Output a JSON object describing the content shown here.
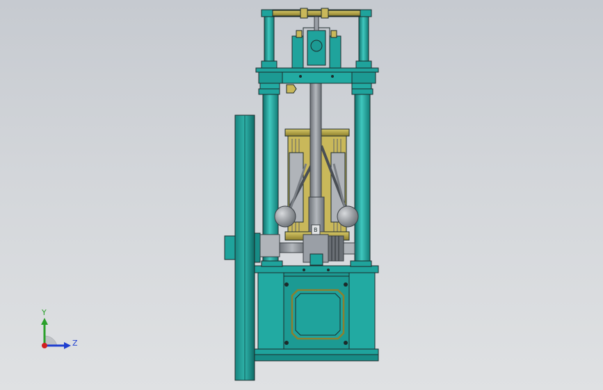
{
  "viewport": {
    "background_top": "#c6cad0",
    "background_bottom": "#dfe1e3"
  },
  "model": {
    "part_colors": {
      "teal": "#1fa39c",
      "teal_dark": "#0f6f6a",
      "teal_light": "#3fc7be",
      "brass": "#b8a84a",
      "steel": "#9a9fa6",
      "steel_dark": "#5d6268",
      "outline": "#1c2a2a"
    }
  },
  "triad": {
    "y_label": "Y",
    "z_label": "Z",
    "y_color": "#2aa02a",
    "z_color": "#1f3fd0",
    "x_color": "#d02020"
  }
}
